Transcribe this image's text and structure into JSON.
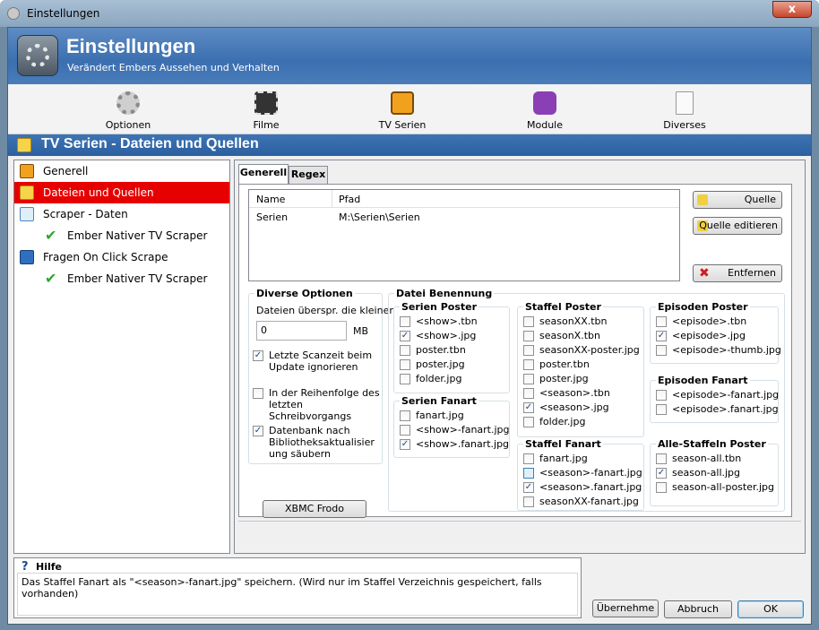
{
  "window": {
    "title": "Einstellungen",
    "close": "x"
  },
  "header": {
    "title": "Einstellungen",
    "subtitle": "Verändert Embers Aussehen und Verhalten"
  },
  "toolbar": [
    "Optionen",
    "Filme",
    "TV Serien",
    "Module",
    "Diverses"
  ],
  "section_title": "TV Serien - Dateien und Quellen",
  "tree": [
    "Generell",
    "Dateien und Quellen",
    "Scraper - Daten",
    "Ember Nativer TV Scraper",
    "Fragen On Click Scrape",
    "Ember Nativer TV Scraper"
  ],
  "tabs": [
    "Generell",
    "Regex"
  ],
  "grid": {
    "col_name": "Name",
    "col_path": "Pfad",
    "rows": [
      {
        "name": "Serien",
        "path": "M:\\Serien\\Serien"
      }
    ]
  },
  "buttons": {
    "quelle": "Quelle",
    "quelle_edit": "Quelle editieren",
    "entfernen": "Entfernen",
    "xbmc": "XBMC Frodo",
    "apply": "Übernehme",
    "cancel": "Abbruch",
    "ok": "OK"
  },
  "diverse": {
    "title": "Diverse Optionen",
    "skip_label": "Dateien überspr. die kleiner",
    "skip_value": "0",
    "unit": "MB",
    "opt1": "Letzte Scanzeit beim Update ignorieren",
    "opt2": "In der Reihenfolge des letzten Schreibvorgangs",
    "opt3": "Datenbank nach Bibliotheksaktualisier ung säubern"
  },
  "naming_title": "Datei Benennung",
  "serien_poster": {
    "title": "Serien Poster",
    "items": [
      "<show>.tbn",
      "<show>.jpg",
      "poster.tbn",
      "poster.jpg",
      "folder.jpg"
    ]
  },
  "serien_fanart": {
    "title": "Serien Fanart",
    "items": [
      "fanart.jpg",
      "<show>-fanart.jpg",
      "<show>.fanart.jpg"
    ]
  },
  "staffel_poster": {
    "title": "Staffel Poster",
    "items": [
      "seasonXX.tbn",
      "seasonX.tbn",
      "seasonXX-poster.jpg",
      "poster.tbn",
      "poster.jpg",
      "<season>.tbn",
      "<season>.jpg",
      "folder.jpg"
    ]
  },
  "staffel_fanart": {
    "title": "Staffel Fanart",
    "items": [
      "fanart.jpg",
      "<season>-fanart.jpg",
      "<season>.fanart.jpg",
      "seasonXX-fanart.jpg"
    ]
  },
  "episoden_poster": {
    "title": "Episoden Poster",
    "items": [
      "<episode>.tbn",
      "<episode>.jpg",
      "<episode>-thumb.jpg"
    ]
  },
  "episoden_fanart": {
    "title": "Episoden Fanart",
    "items": [
      "<episode>-fanart.jpg",
      "<episode>.fanart.jpg"
    ]
  },
  "alle_staffeln": {
    "title": "Alle-Staffeln Poster",
    "items": [
      "season-all.tbn",
      "season-all.jpg",
      "season-all-poster.jpg"
    ]
  },
  "help": {
    "title": "Hilfe",
    "text": "Das Staffel Fanart als \"<season>-fanart.jpg\" speichern. (Wird nur im Staffel Verzeichnis gespeichert, falls vorhanden)"
  }
}
